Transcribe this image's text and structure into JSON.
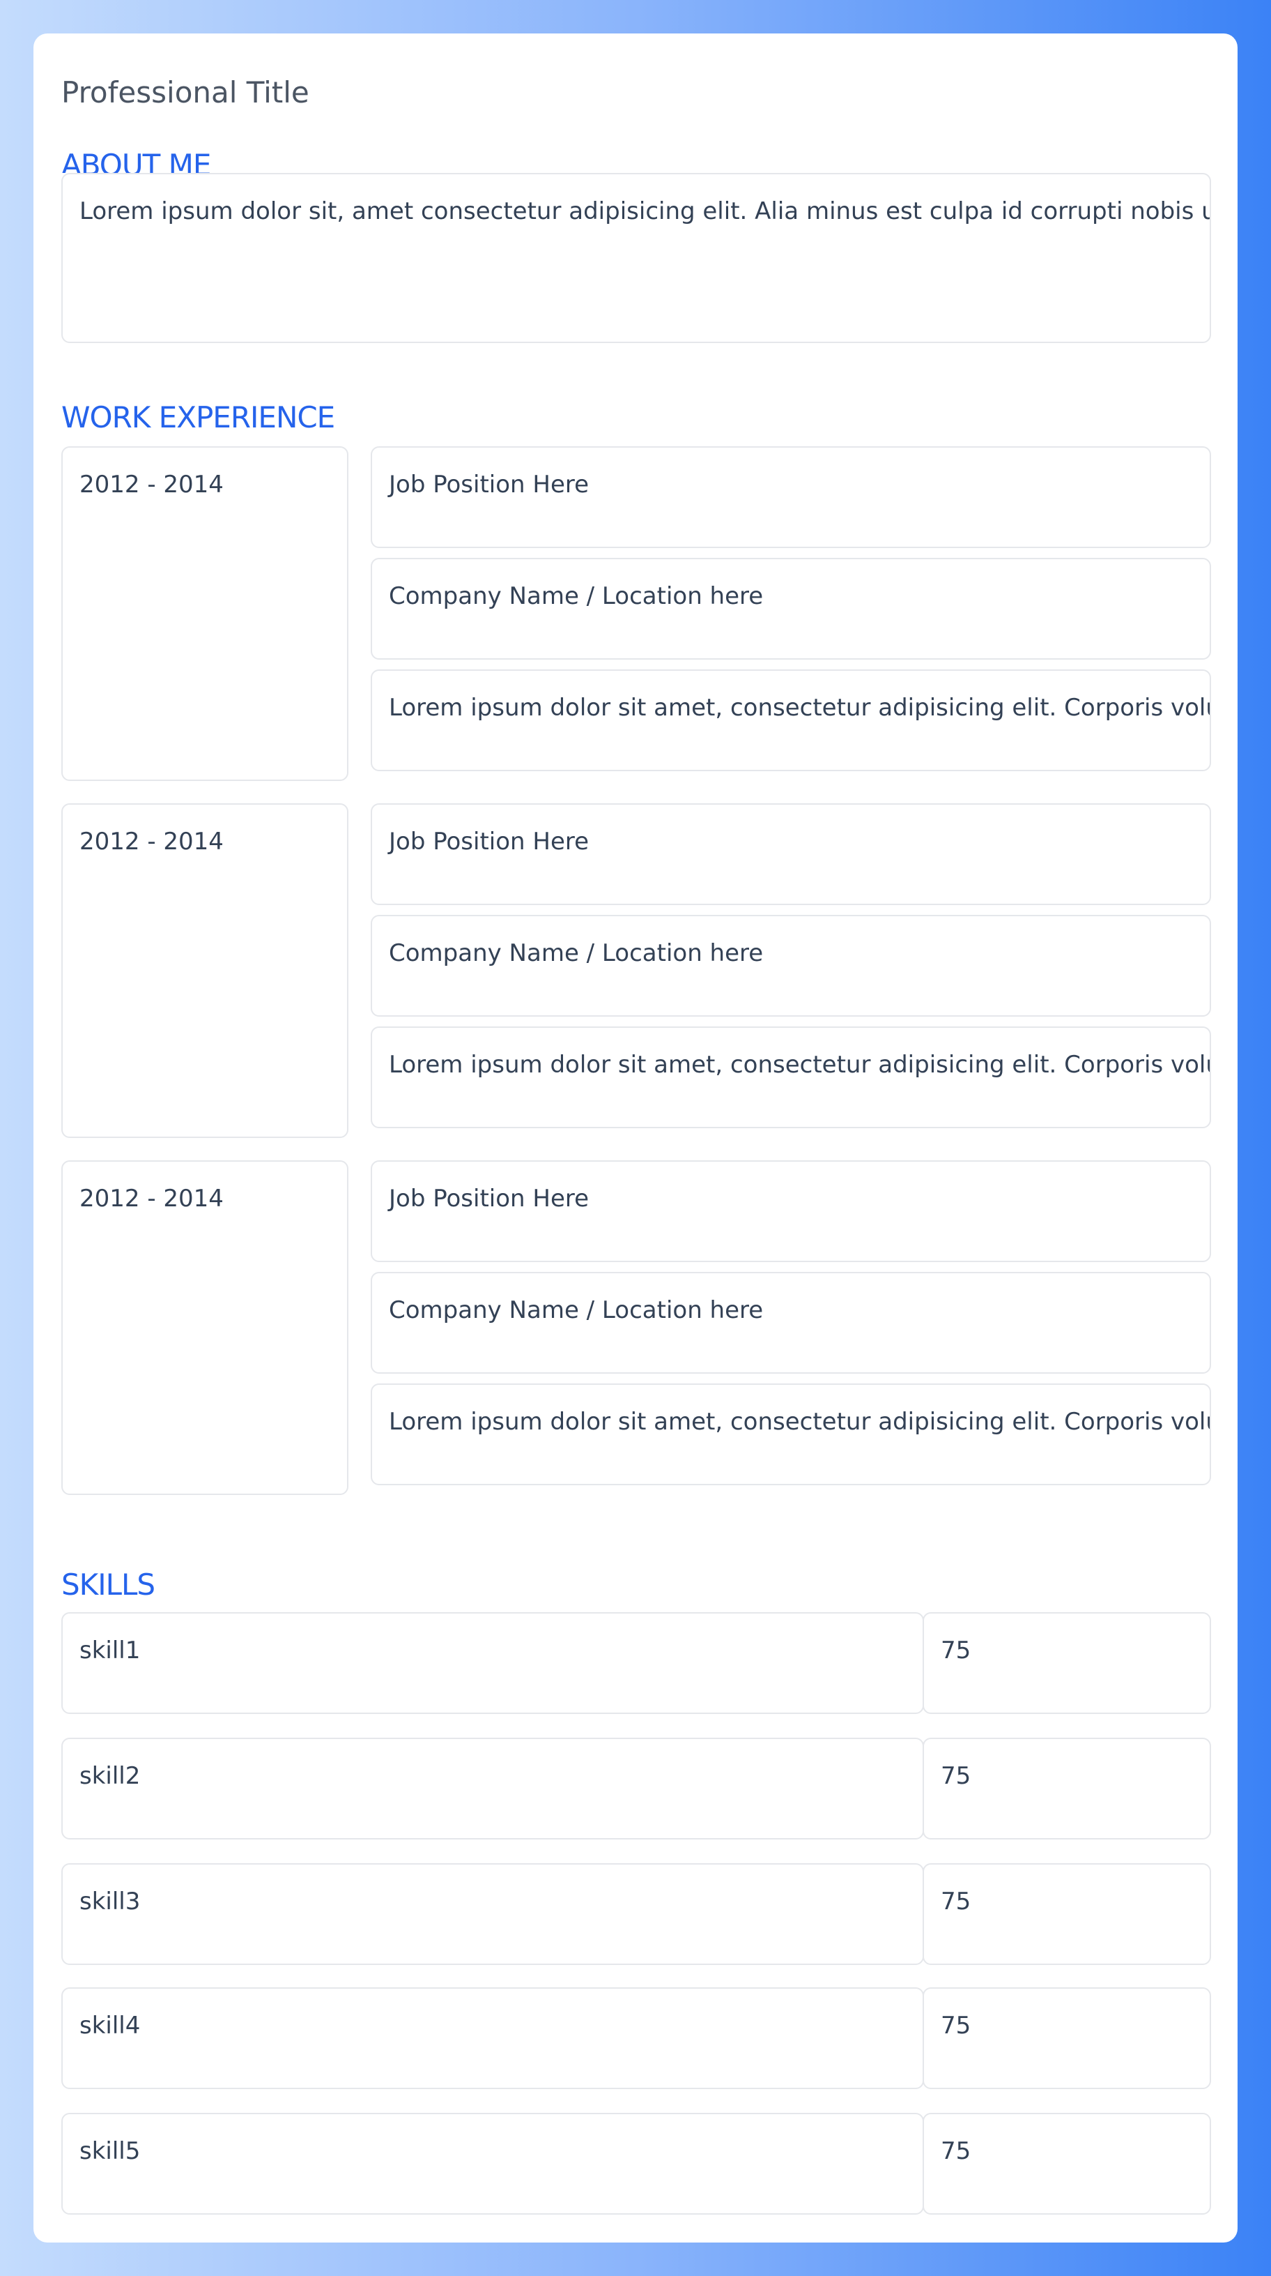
{
  "profile": {
    "professional_title": "Professional Title"
  },
  "about": {
    "heading": "ABOUT ME",
    "text": "Lorem ipsum dolor sit, amet consectetur adipisicing elit. Alia minus est culpa id corrupti nobis ullam ha"
  },
  "work": {
    "heading": "WORK EXPERIENCE",
    "entries": [
      {
        "years": "2012 - 2014",
        "position": "Job Position Here",
        "company": "Company Name / Location here",
        "description": "Lorem ipsum dolor sit amet, consectetur adipisicing elit. Corporis voluptati"
      },
      {
        "years": "2012 - 2014",
        "position": "Job Position Here",
        "company": "Company Name / Location here",
        "description": "Lorem ipsum dolor sit amet, consectetur adipisicing elit. Corporis voluptati"
      },
      {
        "years": "2012 - 2014",
        "position": "Job Position Here",
        "company": "Company Name / Location here",
        "description": "Lorem ipsum dolor sit amet, consectetur adipisicing elit. Corporis voluptati"
      }
    ]
  },
  "skills": {
    "heading": "SKILLS",
    "items": [
      {
        "name": "skill1",
        "level": "75"
      },
      {
        "name": "skill2",
        "level": "75"
      },
      {
        "name": "skill3",
        "level": "75"
      },
      {
        "name": "skill4",
        "level": "75"
      },
      {
        "name": "skill5",
        "level": "75"
      }
    ]
  },
  "colors": {
    "accent": "#2563eb",
    "border": "#e5e7eb",
    "text": "#334155"
  }
}
